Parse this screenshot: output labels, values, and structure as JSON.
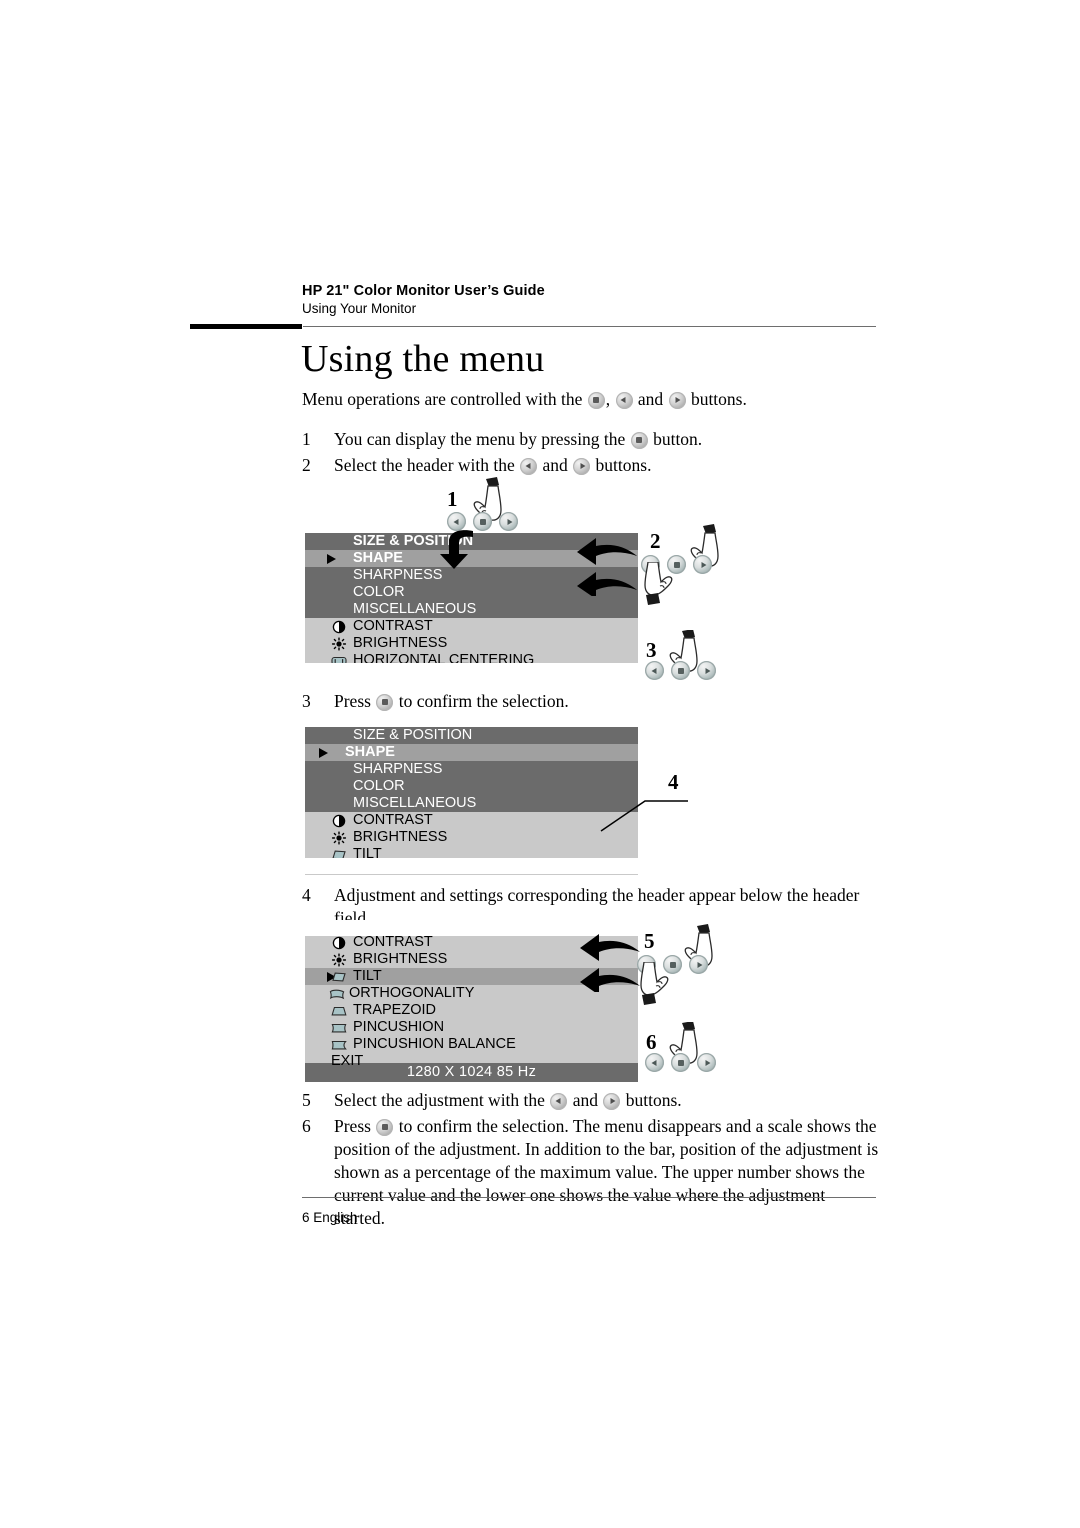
{
  "header": {
    "title": "HP 21\" Color Monitor User’s Guide",
    "subtitle": "Using Your Monitor"
  },
  "page_title": "Using the menu",
  "intro": {
    "part1": "Menu operations are controlled with the ",
    "part2": ", ",
    "part3": " and ",
    "part4": " buttons."
  },
  "steps": [
    {
      "num": "1",
      "parts": [
        "You can display the menu by pressing the ",
        " button."
      ],
      "icons": [
        "menu"
      ]
    },
    {
      "num": "2",
      "parts": [
        "Select the header with the ",
        " and ",
        " buttons."
      ],
      "icons": [
        "left",
        "right"
      ]
    },
    {
      "num": "3",
      "parts": [
        "Press ",
        " to confirm the selection."
      ],
      "icons": [
        "menu"
      ]
    },
    {
      "num": "4",
      "parts": [
        "Adjustment and settings corresponding the header appear below the header field."
      ],
      "icons": []
    },
    {
      "num": "5",
      "parts": [
        "Select the adjustment with the ",
        " and ",
        " buttons."
      ],
      "icons": [
        "left",
        "right"
      ]
    },
    {
      "num": "6",
      "parts": [
        "Press ",
        " to confirm the selection. The menu disappears and a scale shows the position of the adjustment. In addition to the bar, position of the adjustment is shown as a percentage of the maximum value. The upper number shows the current value and the lower one shows the value where the adjustment started."
      ],
      "icons": [
        "menu"
      ]
    }
  ],
  "osd1": {
    "headers": [
      {
        "label": "SIZE & POSITION",
        "title": true,
        "selected": false,
        "caret": false
      },
      {
        "label": "SHAPE",
        "title": false,
        "selected": true,
        "caret": true
      },
      {
        "label": "SHARPNESS",
        "title": false,
        "selected": false,
        "caret": false
      },
      {
        "label": "COLOR",
        "title": false,
        "selected": false,
        "caret": false
      },
      {
        "label": "MISCELLANEOUS",
        "title": false,
        "selected": false,
        "caret": false
      }
    ],
    "items": [
      {
        "label": "CONTRAST",
        "icon": "contrast-icon"
      },
      {
        "label": "BRIGHTNESS",
        "icon": "brightness-icon"
      },
      {
        "label": "HORIZONTAL CENTERING",
        "icon": "horizontal-centering-icon"
      }
    ]
  },
  "osd2": {
    "headers": [
      {
        "label": "SIZE & POSITION",
        "title": false,
        "selected": false,
        "caret": false
      },
      {
        "label": "SHAPE",
        "title": true,
        "selected": true,
        "caret": true
      },
      {
        "label": "SHARPNESS",
        "title": false,
        "selected": false,
        "caret": false
      },
      {
        "label": "COLOR",
        "title": false,
        "selected": false,
        "caret": false
      },
      {
        "label": "MISCELLANEOUS",
        "title": false,
        "selected": false,
        "caret": false
      }
    ],
    "items": [
      {
        "label": "CONTRAST",
        "icon": "contrast-icon"
      },
      {
        "label": "BRIGHTNESS",
        "icon": "brightness-icon"
      },
      {
        "label": "TILT",
        "icon": "tilt-icon"
      }
    ]
  },
  "osd3": {
    "items": [
      {
        "label": "CONTRAST",
        "icon": "contrast-icon",
        "selected": false,
        "caret": false
      },
      {
        "label": "BRIGHTNESS",
        "icon": "brightness-icon",
        "selected": false,
        "caret": false
      },
      {
        "label": "TILT",
        "icon": "tilt-icon",
        "selected": true,
        "caret": true
      },
      {
        "label": "ORTHOGONALITY",
        "icon": "orthogonality-icon",
        "selected": false,
        "caret": false
      },
      {
        "label": "TRAPEZOID",
        "icon": "trapezoid-icon",
        "selected": false,
        "caret": false
      },
      {
        "label": "PINCUSHION",
        "icon": "pincushion-icon",
        "selected": false,
        "caret": false
      },
      {
        "label": "PINCUSHION BALANCE",
        "icon": "pincushion-balance-icon",
        "selected": false,
        "caret": false
      },
      {
        "label": "EXIT",
        "icon": "none",
        "selected": false,
        "caret": false
      }
    ],
    "status": "1280 X 1024  85 Hz"
  },
  "callouts": {
    "c1": "1",
    "c2": "2",
    "c3": "3",
    "c4": "4",
    "c5": "5",
    "c6": "6"
  },
  "footer": {
    "text": "6 English"
  },
  "colors": {
    "osd_dark": "#6b6b6b",
    "osd_light": "#c9c9c9",
    "osd_selected": "#a0a0a0",
    "geometry_icon": "#a8c3c6",
    "rule": "#6e6e6e"
  }
}
